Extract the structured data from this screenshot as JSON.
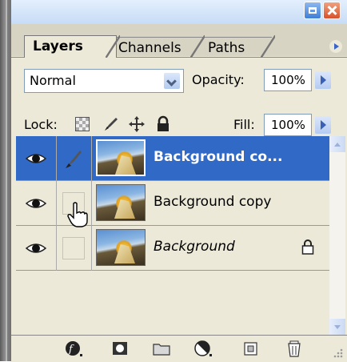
{
  "tabs": [
    "Layers",
    "Channels",
    "Paths"
  ],
  "blend_mode": {
    "selected": "Normal"
  },
  "opacity": {
    "label": "Opacity:",
    "value": "100%"
  },
  "lock": {
    "label": "Lock:"
  },
  "fill": {
    "label": "Fill:",
    "value": "100%"
  },
  "layers": [
    {
      "name": "Background co...",
      "selected": true,
      "visible": true,
      "locked": false,
      "italic": false
    },
    {
      "name": "Background copy",
      "selected": false,
      "visible": true,
      "locked": false,
      "italic": false
    },
    {
      "name": "Background",
      "selected": false,
      "visible": true,
      "locked": true,
      "italic": true
    }
  ],
  "bottom_icons": [
    "layer-style-icon",
    "mask-icon",
    "folder-icon",
    "adjustment-layer-icon",
    "new-layer-icon",
    "trash-icon"
  ],
  "colors": {
    "selection": "#3169c6",
    "panel": "#ece9d8",
    "accent_arrow": "#3a5fb3"
  }
}
